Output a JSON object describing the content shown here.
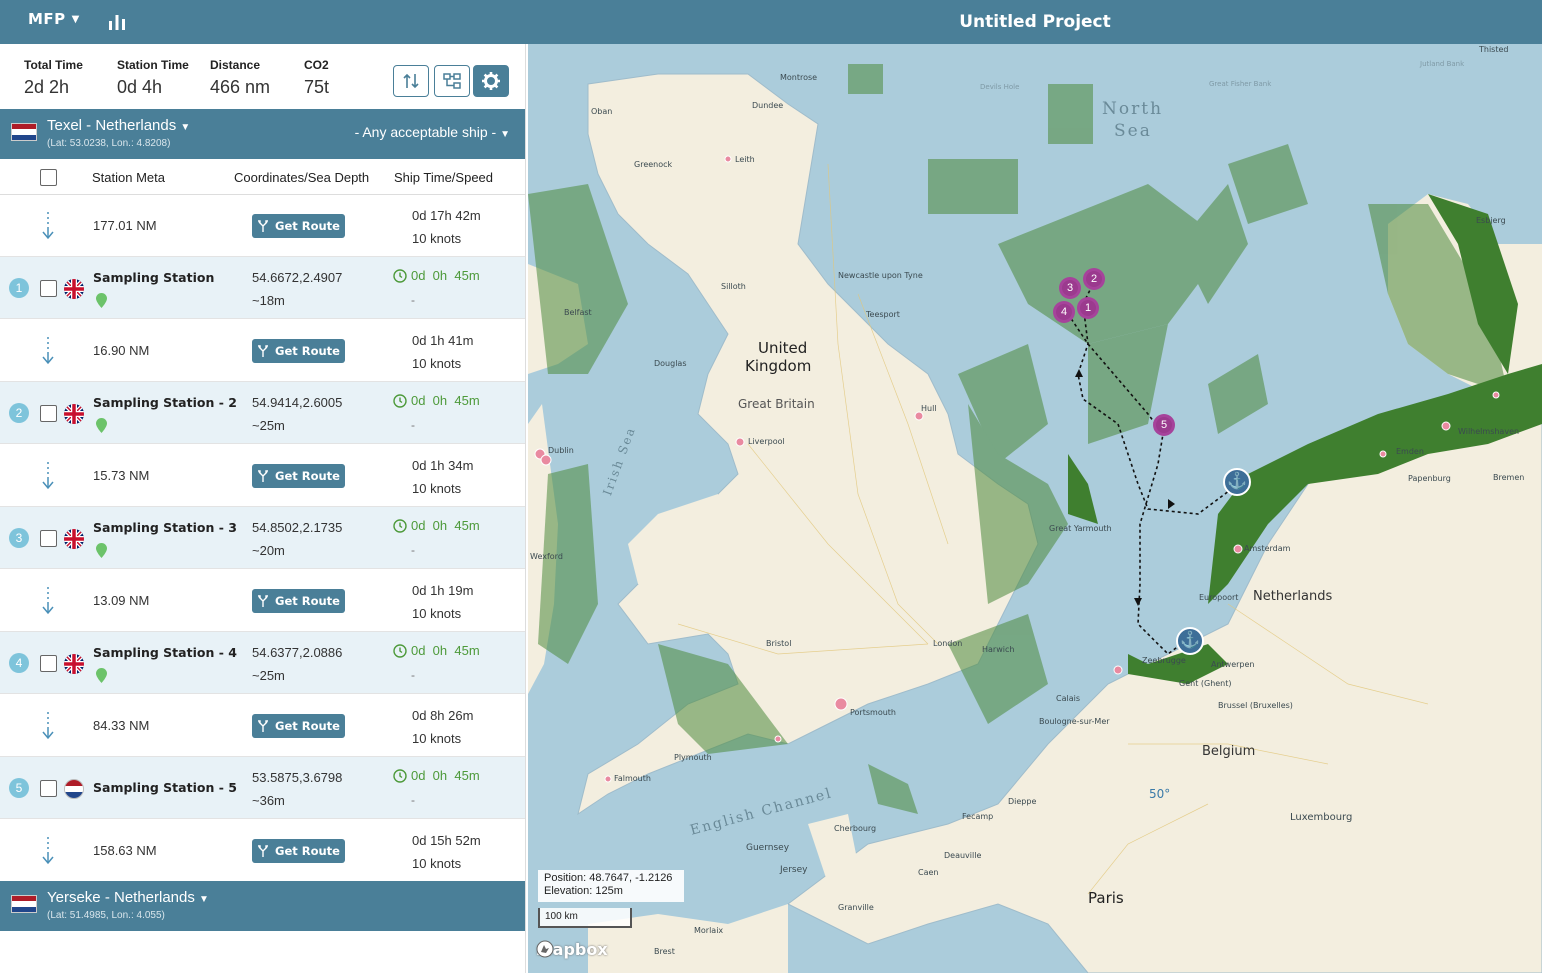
{
  "header": {
    "logo": "MFP",
    "title": "Untitled Project"
  },
  "stats": {
    "total_time_label": "Total Time",
    "total_time": "2d 2h",
    "station_time_label": "Station Time",
    "station_time": "0d 4h",
    "distance_label": "Distance",
    "distance": "466 nm",
    "co2_label": "CO2",
    "co2": "75t"
  },
  "origin": {
    "name": "Texel - Netherlands",
    "coords": "(Lat: 53.0238, Lon.: 4.8208)",
    "ship": "- Any acceptable ship -"
  },
  "destination": {
    "name": "Yerseke - Netherlands",
    "coords": "(Lat: 51.4985, Lon.: 4.055)"
  },
  "table": {
    "col_meta": "Station Meta",
    "col_coords": "Coordinates/Sea Depth",
    "col_time": "Ship Time/Speed"
  },
  "route_button": "Get Route",
  "legs": [
    {
      "distance": "177.01 NM",
      "time": "0d 17h 42m",
      "speed": "10 knots"
    },
    {
      "distance": "16.90 NM",
      "time": "0d 1h 41m",
      "speed": "10 knots"
    },
    {
      "distance": "15.73 NM",
      "time": "0d 1h 34m",
      "speed": "10 knots"
    },
    {
      "distance": "13.09 NM",
      "time": "0d 1h 19m",
      "speed": "10 knots"
    },
    {
      "distance": "84.33 NM",
      "time": "0d 8h 26m",
      "speed": "10 knots"
    },
    {
      "distance": "158.63 NM",
      "time": "0d 15h 52m",
      "speed": "10 knots"
    }
  ],
  "stations": [
    {
      "num": "1",
      "name": "Sampling Station",
      "coords": "54.6672,2.4907",
      "depth": "~18m",
      "time": "0d  0h  45m",
      "extra": "-",
      "flag": "uk"
    },
    {
      "num": "2",
      "name": "Sampling Station - 2",
      "coords": "54.9414,2.6005",
      "depth": "~25m",
      "time": "0d  0h  45m",
      "extra": "-",
      "flag": "uk"
    },
    {
      "num": "3",
      "name": "Sampling Station - 3",
      "coords": "54.8502,2.1735",
      "depth": "~20m",
      "time": "0d  0h  45m",
      "extra": "-",
      "flag": "uk"
    },
    {
      "num": "4",
      "name": "Sampling Station - 4",
      "coords": "54.6377,2.0886",
      "depth": "~25m",
      "time": "0d  0h  45m",
      "extra": "-",
      "flag": "uk"
    },
    {
      "num": "5",
      "name": "Sampling Station - 5",
      "coords": "53.5875,3.6798",
      "depth": "~36m",
      "time": "0d  0h  45m",
      "extra": "-",
      "flag": "nl"
    }
  ],
  "map": {
    "position": "Position: 48.7647, -1.2126",
    "elevation": "Elevation: 125m",
    "scale": "100 km",
    "attribution": "mapbox",
    "labels": {
      "north_sea_1": "North",
      "north_sea_2": "Sea",
      "uk_1": "United",
      "uk_2": "Kingdom",
      "gb": "Great Britain",
      "irish_sea": "Irish Sea",
      "english_channel": "English Channel",
      "netherlands": "Netherlands",
      "belgium": "Belgium",
      "paris": "Paris",
      "luxembourg": "Luxembourg",
      "lat50": "50°",
      "newcastle": "Newcastle upon Tyne",
      "liverpool": "Liverpool",
      "london": "London",
      "bristol": "Bristol",
      "emden": "Emden",
      "bremen": "Bremen",
      "papenburg": "Papenburg",
      "wilhelmshaven": "Wilhelmshaven",
      "esbjerg": "Esbjerg",
      "antwerpen": "Antwerpen",
      "gent": "Gent (Ghent)",
      "brussel": "Brussel (Bruxelles)",
      "zeebrugge": "Zeebrugge",
      "calais": "Calais",
      "boulogne": "Boulogne-sur-Mer",
      "dieppe": "Dieppe",
      "fecamp": "Fecamp",
      "cherbourg": "Cherbourg",
      "caen": "Caen",
      "deauville": "Deauville",
      "guernsey": "Guernsey",
      "jersey": "Jersey",
      "granville": "Granville",
      "morlaix": "Morlaix",
      "brest": "Brest",
      "plymouth": "Plymouth",
      "falmouth": "Falmouth",
      "portsmouth": "Portsmouth",
      "hull": "Hull",
      "leith": "Leith",
      "greenock": "Greenock",
      "oban": "Oban",
      "dundee": "Dundee",
      "montrose": "Montrose",
      "douglas": "Douglas",
      "belfast": "Belfast",
      "dublin": "Dublin",
      "wexford": "Wexford",
      "silloth": "Silloth",
      "teesport": "Teesport",
      "great_yarmouth": "Great Yarmouth",
      "europoort": "Europoort",
      "amsterdam": "Amsterdam",
      "harwich": "Harwich",
      "thisted": "Thisted",
      "jutland": "Jutland Bank",
      "fisher": "Great Fisher Bank",
      "devils": "Devils Hole"
    }
  },
  "colors": {
    "header": "#4a7f98",
    "station_row": "#e8f2f7",
    "sea": "#abccdb",
    "land": "#f3eedf",
    "protected": "#4d8a3c",
    "cluster": "#9b3a8e",
    "anchor": "#3d6e98"
  }
}
